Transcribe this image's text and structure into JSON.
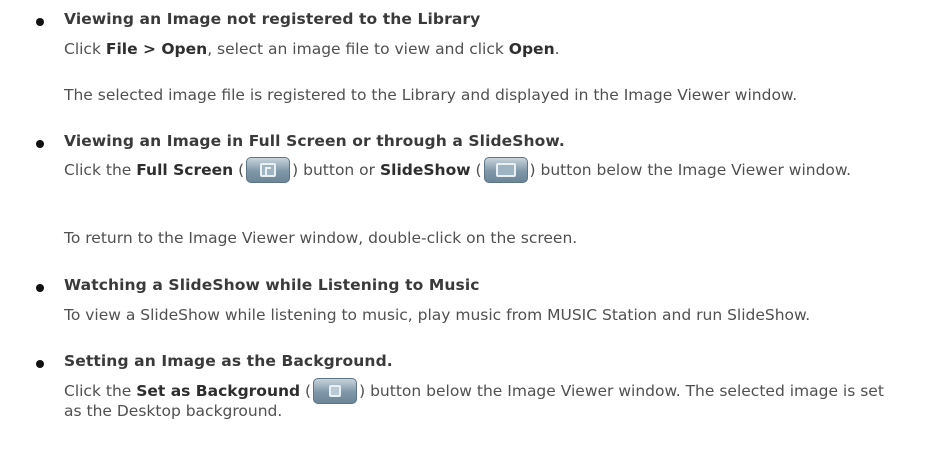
{
  "sections": [
    {
      "heading": "Viewing an Image not registered to the Library",
      "line1": {
        "pre": "Click ",
        "menu": "File > Open",
        "mid": ", select an image file to view and click ",
        "open": "Open",
        "post": "."
      },
      "line2": "The selected image file is registered to the Library and displayed in the Image Viewer window."
    },
    {
      "heading": "Viewing an Image in Full Screen or through a SlideShow.",
      "line1": {
        "pre": "Click the ",
        "full_screen": "Full Screen",
        "paren_open_1": " (",
        "paren_close_1": ") button or ",
        "slideshow": "SlideShow",
        "paren_open_2": " (",
        "post": ") button below the Image Viewer window."
      },
      "full_screen_icon": "full-screen-icon",
      "slideshow_icon": "slideshow-icon",
      "line2": "To return to the Image Viewer window, double-click on the screen."
    },
    {
      "heading": "Watching a SlideShow while Listening to Music",
      "line1": "To view a SlideShow while listening to music, play music from MUSIC Station and run SlideShow."
    },
    {
      "heading": "Setting an Image as the Background.",
      "line1": {
        "pre": "Click the ",
        "set_bg": "Set as Background",
        "paren_open": " (",
        "post": ") button below the Image Viewer window. The selected image is set as the Desktop background."
      },
      "set_bg_icon": "set-as-background-icon"
    }
  ],
  "colors": {
    "text": "#505050",
    "bold_text": "#2e2e2e",
    "button_blue": "#7f97a8"
  }
}
